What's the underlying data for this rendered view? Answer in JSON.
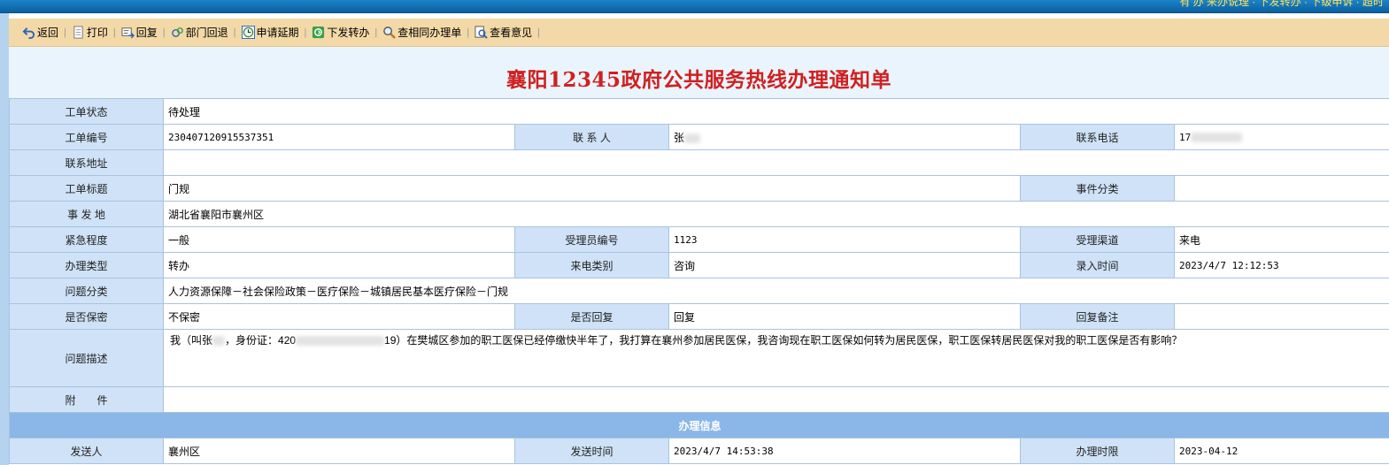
{
  "topbar": {
    "links_text": "有 办 来办说理 · 下发转办 · 下级申诉 · 超时"
  },
  "toolbar": {
    "items": [
      {
        "label": "返回",
        "icon": "back-arrow-icon"
      },
      {
        "label": "打印",
        "icon": "print-icon"
      },
      {
        "label": "回复",
        "icon": "reply-icon"
      },
      {
        "label": "部门回退",
        "icon": "department-return-icon"
      },
      {
        "label": "申请延期",
        "icon": "clock-icon"
      },
      {
        "label": "下发转办",
        "icon": "dispatch-icon"
      },
      {
        "label": "查相同办理单",
        "icon": "magnifier-icon"
      },
      {
        "label": "查看意见",
        "icon": "view-opinion-icon"
      }
    ]
  },
  "page": {
    "title": "襄阳12345政府公共服务热线办理通知单"
  },
  "form": {
    "status_label": "工单状态",
    "status": "待处理",
    "order_no_label": "工单编号",
    "order_no": "230407120915537351",
    "contact_label": "联 系 人",
    "contact": "张",
    "phone_label": "联系电话",
    "phone": "17",
    "address_label": "联系地址",
    "address": "",
    "subject_label": "工单标题",
    "subject": "门规",
    "event_category_label": "事件分类",
    "event_category": "",
    "location_label": "事 发 地",
    "location": "湖北省襄阳市襄州区",
    "urgency_label": "紧急程度",
    "urgency": "一般",
    "operator_no_label": "受理员编号",
    "operator_no": "1123",
    "channel_label": "受理渠道",
    "channel": "来电",
    "handle_type_label": "办理类型",
    "handle_type": "转办",
    "call_type_label": "来电类别",
    "call_type": "咨询",
    "entry_time_label": "录入时间",
    "entry_time": "2023/4/7 12:12:53",
    "problem_category_label": "问题分类",
    "problem_category": "人力资源保障－社会保险政策－医疗保险－城镇居民基本医疗保险－门规",
    "confidential_label": "是否保密",
    "confidential": "不保密",
    "need_reply_label": "是否回复",
    "need_reply": "回复",
    "reply_note_label": "回复备注",
    "reply_note": "",
    "description_label": "问题描述",
    "description_part1": "我（叫张",
    "description_part2": "，身份证：420",
    "description_part3": "19）在樊城区参加的职工医保已经停缴快半年了，我打算在襄州参加居民医保，我咨询现在职工医保如何转为居民医保，职工医保转居民医保对我的职工医保是否有影响？",
    "attachment_label": "附　　件",
    "attachment": ""
  },
  "handling": {
    "section_title": "办理信息",
    "sender_label": "发送人",
    "sender": "襄州区",
    "send_time_label": "发送时间",
    "send_time": "2023/4/7 14:53:38",
    "deadline_label": "办理时限",
    "deadline": "2023-04-12"
  }
}
